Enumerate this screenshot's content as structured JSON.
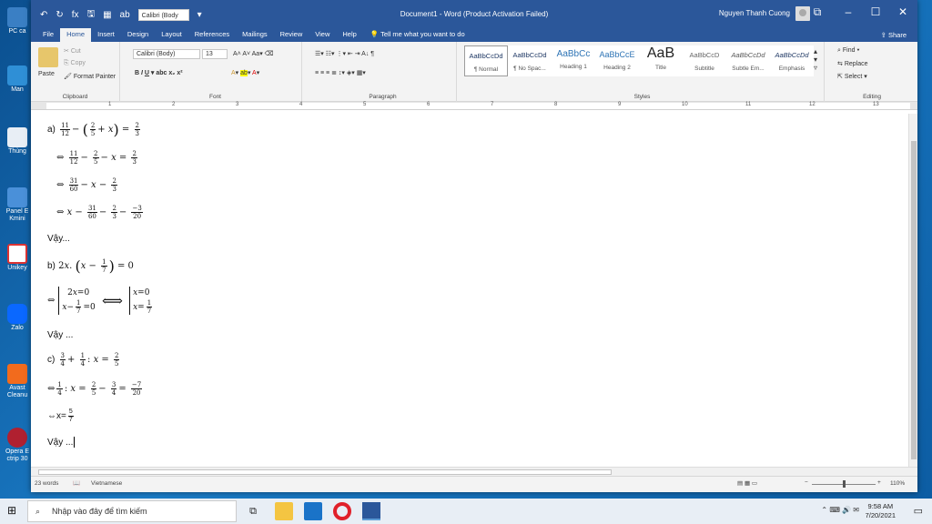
{
  "desktop": {
    "icons": [
      {
        "label": "PC ca"
      },
      {
        "label": "Man"
      },
      {
        "label": "Thùng"
      },
      {
        "label": "Panel E Kmini"
      },
      {
        "label": "Unikey"
      },
      {
        "label": "Zalo"
      },
      {
        "label": "Avast Cleanu"
      },
      {
        "label": "Opera E ctrip 30"
      }
    ]
  },
  "titlebar": {
    "title": "Document1 - Word (Product Activation Failed)",
    "user": "Nguyen Thanh Cuong",
    "font_box": "Calibri (Body"
  },
  "tabs": [
    "File",
    "Home",
    "Insert",
    "Design",
    "Layout",
    "References",
    "Mailings",
    "Review",
    "View",
    "Help"
  ],
  "active_tab": "Home",
  "tellme": "Tell me what you want to do",
  "share": "Share",
  "ribbon": {
    "clipboard": {
      "paste": "Paste",
      "cut": "Cut",
      "copy": "Copy",
      "format_painter": "Format Painter",
      "label": "Clipboard"
    },
    "font": {
      "name": "Calibri (Body)",
      "size": "13",
      "label": "Font"
    },
    "paragraph": {
      "label": "Paragraph"
    },
    "styles": {
      "label": "Styles",
      "items": [
        {
          "preview": "AaBbCcDd",
          "name": "¶ Normal"
        },
        {
          "preview": "AaBbCcDd",
          "name": "¶ No Spac..."
        },
        {
          "preview": "AaBbCc",
          "name": "Heading 1"
        },
        {
          "preview": "AaBbCcE",
          "name": "Heading 2"
        },
        {
          "preview": "AaB",
          "name": "Title"
        },
        {
          "preview": "AaBbCcD",
          "name": "Subtitle"
        },
        {
          "preview": "AaBbCcDd",
          "name": "Subtle Em..."
        },
        {
          "preview": "AaBbCcDd",
          "name": "Emphasis"
        }
      ]
    },
    "editing": {
      "find": "Find",
      "replace": "Replace",
      "select": "Select",
      "label": "Editing"
    }
  },
  "ruler": [
    "1",
    "2",
    "3",
    "4",
    "5",
    "6",
    "7",
    "8",
    "9",
    "10",
    "11",
    "12",
    "13"
  ],
  "document": {
    "a_label": "a)",
    "vay": "Vậy...",
    "vay2": "Vậy ...",
    "vay3": "Vậy ...",
    "b_label": "b)",
    "c_label": "c)"
  },
  "status": {
    "words": "23 words",
    "language": "Vietnamese",
    "zoom": "110%"
  },
  "taskbar": {
    "search": "Nhập vào đây để tìm kiếm",
    "time": "9:58 AM",
    "date": "7/20/2021"
  },
  "colors": {
    "word_blue": "#2b579a",
    "opera_red": "#e0202a"
  }
}
